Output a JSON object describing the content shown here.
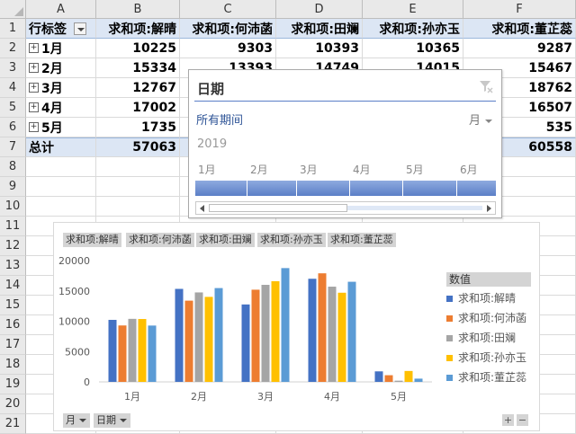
{
  "columns": [
    "A",
    "B",
    "C",
    "D",
    "E",
    "F"
  ],
  "rows": [
    "1",
    "2",
    "3",
    "4",
    "5",
    "6",
    "7",
    "8",
    "9",
    "10",
    "11",
    "12",
    "13",
    "14",
    "15",
    "16",
    "17",
    "18",
    "19",
    "20",
    "21"
  ],
  "pivot": {
    "row_label_header": "行标签",
    "value_headers": [
      "求和项:解晴",
      "求和项:何沛菡",
      "求和项:田斓",
      "求和项:孙亦玉",
      "求和项:董芷蕊"
    ],
    "rows": [
      {
        "label": "1月",
        "values": [
          "10225",
          "9303",
          "10393",
          "10365",
          "9287"
        ]
      },
      {
        "label": "2月",
        "values": [
          "15334",
          "13393",
          "14749",
          "14015",
          "15467"
        ]
      },
      {
        "label": "3月",
        "values": [
          "12767",
          "",
          "",
          "",
          "18762"
        ]
      },
      {
        "label": "4月",
        "values": [
          "17002",
          "",
          "",
          "",
          "16507"
        ]
      },
      {
        "label": "5月",
        "values": [
          "1735",
          "",
          "",
          "",
          "535"
        ]
      }
    ],
    "total_label": "总计",
    "total_values": [
      "57063",
      "",
      "",
      "",
      "60558"
    ]
  },
  "timeline": {
    "title": "日期",
    "period_label": "所有期间",
    "level": "月",
    "year": "2019",
    "months": [
      "1月",
      "2月",
      "3月",
      "4月",
      "5月",
      "6月"
    ]
  },
  "chart": {
    "field_buttons": [
      "求和项:解晴",
      "求和项:何沛菡",
      "求和项:田斓",
      "求和项:孙亦玉",
      "求和项:董芷蕊"
    ],
    "legend_title": "数值",
    "axis_buttons": [
      "月",
      "日期"
    ],
    "zoom_in": "+",
    "zoom_out": "−"
  },
  "chart_data": {
    "type": "bar",
    "categories": [
      "1月",
      "2月",
      "3月",
      "4月",
      "5月"
    ],
    "series": [
      {
        "name": "求和项:解晴",
        "color": "#4472c4",
        "values": [
          10225,
          15334,
          12767,
          17002,
          1735
        ]
      },
      {
        "name": "求和项:何沛菡",
        "color": "#ed7d31",
        "values": [
          9303,
          13393,
          15200,
          17900,
          1100
        ]
      },
      {
        "name": "求和项:田斓",
        "color": "#a5a5a5",
        "values": [
          10393,
          14749,
          16000,
          15700,
          200
        ]
      },
      {
        "name": "求和项:孙亦玉",
        "color": "#ffc000",
        "values": [
          10365,
          14015,
          16600,
          14700,
          1800
        ]
      },
      {
        "name": "求和项:董芷蕊",
        "color": "#5b9bd5",
        "values": [
          9287,
          15467,
          18762,
          16507,
          535
        ]
      }
    ],
    "yticks": [
      "0",
      "5000",
      "10000",
      "15000",
      "20000"
    ],
    "ylim": [
      0,
      20000
    ],
    "grid": false,
    "legend": "right"
  }
}
